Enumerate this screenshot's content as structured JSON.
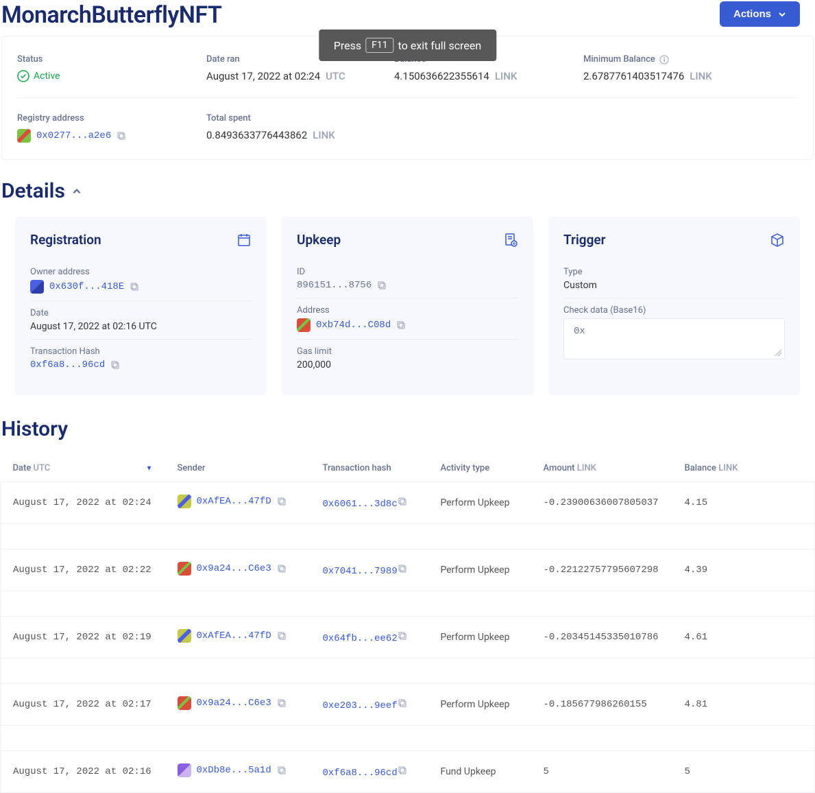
{
  "header": {
    "title": "MonarchButterflyNFT",
    "actions_label": "Actions"
  },
  "fullscreen_toast": {
    "prefix": "Press",
    "key": "F11",
    "suffix": "to exit full screen"
  },
  "summary": {
    "status": {
      "label": "Status",
      "value": "Active"
    },
    "date_ran": {
      "label": "Date ran",
      "value": "August 17, 2022 at 02:24",
      "unit": "UTC"
    },
    "balance": {
      "label": "Balance",
      "value": "4.150636622355614",
      "unit": "LINK"
    },
    "min_balance": {
      "label": "Minimum Balance",
      "value": "2.6787761403517476",
      "unit": "LINK"
    },
    "registry": {
      "label": "Registry address",
      "value": "0x0277...a2e6"
    },
    "total_spent": {
      "label": "Total spent",
      "value": "0.8493633776443862",
      "unit": "LINK"
    }
  },
  "details_heading": "Details",
  "registration_card": {
    "title": "Registration",
    "owner_label": "Owner address",
    "owner_value": "0x630f...418E",
    "date_label": "Date",
    "date_value": "August 17, 2022 at 02:16 UTC",
    "tx_label": "Transaction Hash",
    "tx_value": "0xf6a8...96cd"
  },
  "upkeep_card": {
    "title": "Upkeep",
    "id_label": "ID",
    "id_value": "896151...8756",
    "addr_label": "Address",
    "addr_value": "0xb74d...C08d",
    "gas_label": "Gas limit",
    "gas_value": "200,000"
  },
  "trigger_card": {
    "title": "Trigger",
    "type_label": "Type",
    "type_value": "Custom",
    "check_label": "Check data (Base16)",
    "check_value": "0x"
  },
  "history_heading": "History",
  "history_columns": {
    "date": "Date",
    "date_unit": "UTC",
    "sender": "Sender",
    "tx": "Transaction hash",
    "activity": "Activity type",
    "amount": "Amount",
    "amount_unit": "LINK",
    "balance": "Balance",
    "balance_unit": "LINK"
  },
  "history_rows": [
    {
      "date": "August 17, 2022 at 02:24",
      "sender": "0xAfEA...47fD",
      "icon": "yellow",
      "tx": "0x6061...3d8c",
      "activity": "Perform Upkeep",
      "amount": "-0.23900636007805037",
      "balance": "4.15"
    },
    {
      "date": "August 17, 2022 at 02:22",
      "sender": "0x9a24...C6e3",
      "icon": "red",
      "tx": "0x7041...7989",
      "activity": "Perform Upkeep",
      "amount": "-0.22122757795607298",
      "balance": "4.39"
    },
    {
      "date": "August 17, 2022 at 02:19",
      "sender": "0xAfEA...47fD",
      "icon": "yellow",
      "tx": "0x64fb...ee62",
      "activity": "Perform Upkeep",
      "amount": "-0.20345145335010786",
      "balance": "4.61"
    },
    {
      "date": "August 17, 2022 at 02:17",
      "sender": "0x9a24...C6e3",
      "icon": "red",
      "tx": "0xe203...9eef",
      "activity": "Perform Upkeep",
      "amount": "-0.185677986260155",
      "balance": "4.81"
    },
    {
      "date": "August 17, 2022 at 02:16",
      "sender": "0xDb8e...5a1d",
      "icon": "violet",
      "tx": "0xf6a8...96cd",
      "activity": "Fund Upkeep",
      "amount": "5",
      "balance": "5"
    }
  ]
}
